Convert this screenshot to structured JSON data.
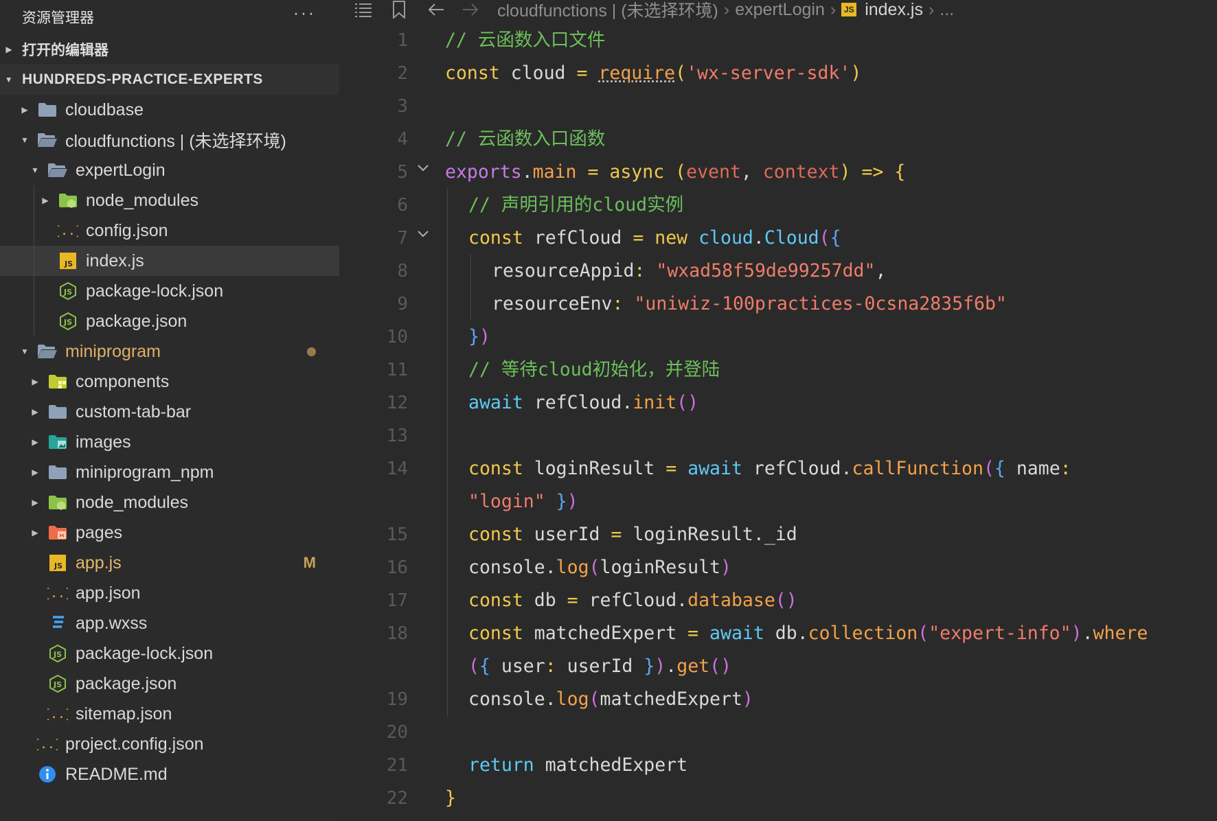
{
  "sidebar": {
    "title": "资源管理器",
    "more": "···",
    "open_editors": "打开的编辑器",
    "project": "HUNDREDS-PRACTICE-EXPERTS",
    "tree": [
      {
        "label": "cloudbase",
        "depth": 0,
        "caret": "right",
        "icon": "folder-icon",
        "kind": "folder"
      },
      {
        "label": "cloudfunctions | (未选择环境)",
        "depth": 0,
        "caret": "down",
        "icon": "cloud-folder-open-icon",
        "kind": "folder-open"
      },
      {
        "label": "expertLogin",
        "depth": 1,
        "caret": "down",
        "icon": "folder-open-icon",
        "kind": "folder-open"
      },
      {
        "label": "node_modules",
        "depth": 2,
        "caret": "right",
        "icon": "node-folder-icon",
        "kind": "node"
      },
      {
        "label": "config.json",
        "depth": 2,
        "caret": "",
        "icon": "json-braces-icon",
        "kind": "json"
      },
      {
        "label": "index.js",
        "depth": 2,
        "caret": "",
        "icon": "js-file-icon",
        "kind": "js",
        "active": true
      },
      {
        "label": "package-lock.json",
        "depth": 2,
        "caret": "",
        "icon": "nodejs-icon",
        "kind": "nodejs"
      },
      {
        "label": "package.json",
        "depth": 2,
        "caret": "",
        "icon": "nodejs-icon",
        "kind": "nodejs"
      },
      {
        "label": "miniprogram",
        "depth": 0,
        "caret": "down",
        "icon": "folder-open-icon",
        "kind": "folder-open",
        "dot": true,
        "mod": "cf"
      },
      {
        "label": "components",
        "depth": 1,
        "caret": "right",
        "icon": "components-folder-icon",
        "kind": "components"
      },
      {
        "label": "custom-tab-bar",
        "depth": 1,
        "caret": "right",
        "icon": "folder-icon",
        "kind": "folder"
      },
      {
        "label": "images",
        "depth": 1,
        "caret": "right",
        "icon": "images-folder-icon",
        "kind": "images"
      },
      {
        "label": "miniprogram_npm",
        "depth": 1,
        "caret": "right",
        "icon": "folder-icon",
        "kind": "folder"
      },
      {
        "label": "node_modules",
        "depth": 1,
        "caret": "right",
        "icon": "node-folder-icon",
        "kind": "node"
      },
      {
        "label": "pages",
        "depth": 1,
        "caret": "right",
        "icon": "pages-folder-icon",
        "kind": "pages"
      },
      {
        "label": "app.js",
        "depth": 1,
        "caret": "",
        "icon": "js-file-icon",
        "kind": "js",
        "mark": "M",
        "mod": "m"
      },
      {
        "label": "app.json",
        "depth": 1,
        "caret": "",
        "icon": "json-braces-icon",
        "kind": "json"
      },
      {
        "label": "app.wxss",
        "depth": 1,
        "caret": "",
        "icon": "css-file-icon",
        "kind": "css"
      },
      {
        "label": "package-lock.json",
        "depth": 1,
        "caret": "",
        "icon": "nodejs-icon",
        "kind": "nodejs"
      },
      {
        "label": "package.json",
        "depth": 1,
        "caret": "",
        "icon": "nodejs-icon",
        "kind": "nodejs"
      },
      {
        "label": "sitemap.json",
        "depth": 1,
        "caret": "",
        "icon": "json-braces-icon",
        "kind": "json"
      },
      {
        "label": "project.config.json",
        "depth": 0,
        "caret": "",
        "icon": "json-braces-icon",
        "kind": "json"
      },
      {
        "label": "README.md",
        "depth": 0,
        "caret": "",
        "icon": "info-icon",
        "kind": "info"
      }
    ]
  },
  "editor": {
    "breadcrumb": {
      "items": [
        "cloudfunctions | (未选择环境)",
        "expertLogin",
        "index.js",
        "..."
      ],
      "file_badge": "JS"
    },
    "lines": [
      {
        "n": "1",
        "tokens": [
          [
            "c",
            "// 云函数入口文件"
          ]
        ]
      },
      {
        "n": "2",
        "tokens": [
          [
            "k",
            "const"
          ],
          [
            "t",
            " cloud "
          ],
          [
            "k",
            "="
          ],
          [
            "t",
            " "
          ],
          [
            "f req",
            "require"
          ],
          [
            "b1",
            "("
          ],
          [
            "s",
            "'wx-server-sdk'"
          ],
          [
            "b1",
            ")"
          ]
        ]
      },
      {
        "n": "3",
        "tokens": []
      },
      {
        "n": "4",
        "tokens": [
          [
            "c",
            "// 云函数入口函数"
          ]
        ]
      },
      {
        "n": "5",
        "fold": true,
        "tokens": [
          [
            "kw2",
            "exports"
          ],
          [
            "p",
            "."
          ],
          [
            "f",
            "main"
          ],
          [
            "t",
            " "
          ],
          [
            "k",
            "="
          ],
          [
            "t",
            " "
          ],
          [
            "k",
            "async"
          ],
          [
            "t",
            " "
          ],
          [
            "b1",
            "("
          ],
          [
            "v",
            "event"
          ],
          [
            "p",
            ", "
          ],
          [
            "v",
            "context"
          ],
          [
            "b1",
            ")"
          ],
          [
            "t",
            " "
          ],
          [
            "k",
            "=>"
          ],
          [
            "t",
            " "
          ],
          [
            "b1",
            "{"
          ]
        ]
      },
      {
        "n": "6",
        "indent": 1,
        "tokens": [
          [
            "c",
            "// 声明引用的cloud实例"
          ]
        ]
      },
      {
        "n": "7",
        "fold": true,
        "indent": 1,
        "tokens": [
          [
            "k",
            "const"
          ],
          [
            "t",
            " refCloud "
          ],
          [
            "k",
            "="
          ],
          [
            "t",
            " "
          ],
          [
            "k",
            "new"
          ],
          [
            "t",
            " "
          ],
          [
            "m",
            "cloud"
          ],
          [
            "p",
            "."
          ],
          [
            "m",
            "Cloud"
          ],
          [
            "b2",
            "("
          ],
          [
            "b3",
            "{"
          ]
        ]
      },
      {
        "n": "8",
        "indent": 2,
        "tokens": [
          [
            "t",
            "resourceAppid"
          ],
          [
            "k",
            ":"
          ],
          [
            "t",
            " "
          ],
          [
            "s",
            "\"wxad58f59de99257dd\""
          ],
          [
            "p",
            ","
          ]
        ]
      },
      {
        "n": "9",
        "indent": 2,
        "tokens": [
          [
            "t",
            "resourceEnv"
          ],
          [
            "k",
            ":"
          ],
          [
            "t",
            " "
          ],
          [
            "s",
            "\"uniwiz-100practices-0csna2835f6b\""
          ]
        ]
      },
      {
        "n": "10",
        "indent": 1,
        "tokens": [
          [
            "b3",
            "}"
          ],
          [
            "b2",
            ")"
          ]
        ]
      },
      {
        "n": "11",
        "indent": 1,
        "tokens": [
          [
            "c",
            "// 等待cloud初始化，并登陆"
          ]
        ]
      },
      {
        "n": "12",
        "indent": 1,
        "tokens": [
          [
            "m",
            "await"
          ],
          [
            "t",
            " refCloud"
          ],
          [
            "p",
            "."
          ],
          [
            "f",
            "init"
          ],
          [
            "b2",
            "()"
          ]
        ]
      },
      {
        "n": "13",
        "tokens": []
      },
      {
        "n": "14",
        "indent": 1,
        "tokens": [
          [
            "k",
            "const"
          ],
          [
            "t",
            " loginResult "
          ],
          [
            "k",
            "="
          ],
          [
            "t",
            " "
          ],
          [
            "m",
            "await"
          ],
          [
            "t",
            " refCloud"
          ],
          [
            "p",
            "."
          ],
          [
            "f",
            "callFunction"
          ],
          [
            "b2",
            "("
          ],
          [
            "b3",
            "{"
          ],
          [
            "t",
            " name"
          ],
          [
            "k",
            ":"
          ]
        ]
      },
      {
        "n": "",
        "indent": 1,
        "tokens": [
          [
            "s",
            "\"login\""
          ],
          [
            "t",
            " "
          ],
          [
            "b3",
            "}"
          ],
          [
            "b2",
            ")"
          ]
        ]
      },
      {
        "n": "15",
        "indent": 1,
        "tokens": [
          [
            "k",
            "const"
          ],
          [
            "t",
            " userId "
          ],
          [
            "k",
            "="
          ],
          [
            "t",
            " loginResult"
          ],
          [
            "p",
            "."
          ],
          [
            "t",
            "_id"
          ]
        ]
      },
      {
        "n": "16",
        "indent": 1,
        "tokens": [
          [
            "t",
            "console"
          ],
          [
            "p",
            "."
          ],
          [
            "f",
            "log"
          ],
          [
            "b2",
            "("
          ],
          [
            "t",
            "loginResult"
          ],
          [
            "b2",
            ")"
          ]
        ]
      },
      {
        "n": "17",
        "indent": 1,
        "tokens": [
          [
            "k",
            "const"
          ],
          [
            "t",
            " db "
          ],
          [
            "k",
            "="
          ],
          [
            "t",
            " refCloud"
          ],
          [
            "p",
            "."
          ],
          [
            "f",
            "database"
          ],
          [
            "b2",
            "()"
          ]
        ]
      },
      {
        "n": "18",
        "indent": 1,
        "tokens": [
          [
            "k",
            "const"
          ],
          [
            "t",
            " matchedExpert "
          ],
          [
            "k",
            "="
          ],
          [
            "t",
            " "
          ],
          [
            "m",
            "await"
          ],
          [
            "t",
            " db"
          ],
          [
            "p",
            "."
          ],
          [
            "f",
            "collection"
          ],
          [
            "b2",
            "("
          ],
          [
            "s",
            "\"expert-info\""
          ],
          [
            "b2",
            ")"
          ],
          [
            "p",
            "."
          ],
          [
            "f",
            "where"
          ]
        ]
      },
      {
        "n": "",
        "indent": 1,
        "tokens": [
          [
            "b2",
            "("
          ],
          [
            "b3",
            "{"
          ],
          [
            "t",
            " user"
          ],
          [
            "k",
            ":"
          ],
          [
            "t",
            " userId "
          ],
          [
            "b3",
            "}"
          ],
          [
            "b2",
            ")"
          ],
          [
            "p",
            "."
          ],
          [
            "f",
            "get"
          ],
          [
            "b2",
            "()"
          ]
        ]
      },
      {
        "n": "19",
        "indent": 1,
        "tokens": [
          [
            "t",
            "console"
          ],
          [
            "p",
            "."
          ],
          [
            "f",
            "log"
          ],
          [
            "b2",
            "("
          ],
          [
            "t",
            "matchedExpert"
          ],
          [
            "b2",
            ")"
          ]
        ]
      },
      {
        "n": "20",
        "tokens": []
      },
      {
        "n": "21",
        "indent": 1,
        "tokens": [
          [
            "m",
            "return"
          ],
          [
            "t",
            " matchedExpert"
          ]
        ]
      },
      {
        "n": "22",
        "tokens": [
          [
            "b1",
            "}"
          ]
        ]
      }
    ]
  }
}
